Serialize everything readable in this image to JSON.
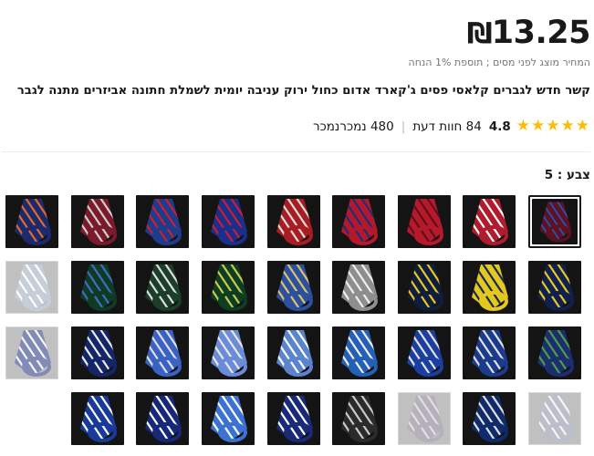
{
  "price": {
    "currency": "₪",
    "value": "13.25"
  },
  "tax_note": "המחיר מוצג לפני מסים ; תוספת 1% הנחה",
  "product_title": "קשר חדש לגברים קלאסי פסים ג'קארד אדום כחול ירוק עניבה יומית לשמלת חתונה אביזרים מתנה לגבר",
  "rating": {
    "value": "4.8",
    "stars": 5,
    "reviews": "84 חוות דעת",
    "sold": "480 נמכרנמכר",
    "separator": "|"
  },
  "color": {
    "label": "צבע : 5",
    "selected_index": 0
  },
  "swatches": [
    {
      "base": "#5e1220",
      "stripe": "#2b4fb0",
      "dim": false
    },
    {
      "base": "#b01c2e",
      "stripe": "#ffffff",
      "dim": false
    },
    {
      "base": "#b5192b",
      "stripe": "#5e0f18",
      "dim": false
    },
    {
      "base": "#b3182b",
      "stripe": "#1d2f7a",
      "dim": false
    },
    {
      "base": "#a81d22",
      "stripe": "#dcdcdc",
      "dim": false
    },
    {
      "base": "#1a2e8c",
      "stripe": "#c8202e",
      "dim": false
    },
    {
      "base": "#1e3c8e",
      "stripe": "#c8202e",
      "dim": false
    },
    {
      "base": "#7b1a2a",
      "stripe": "#cfcfcf",
      "dim": false
    },
    {
      "base": "#1b2a6e",
      "stripe": "#e06a2a",
      "dim": false
    },
    {
      "base": "#10214f",
      "stripe": "#e8c81e",
      "dim": false
    },
    {
      "base": "#e4c71f",
      "stripe": "#14285a",
      "dim": false
    },
    {
      "base": "#0f1d3f",
      "stripe": "#e8c81e",
      "dim": false
    },
    {
      "base": "#8e8e8e",
      "stripe": "#eeeeee",
      "dim": false
    },
    {
      "base": "#2c4f9e",
      "stripe": "#d9c36b",
      "dim": false
    },
    {
      "base": "#0d3d22",
      "stripe": "#c9c94a",
      "dim": false
    },
    {
      "base": "#1b3e2a",
      "stripe": "#dddddd",
      "dim": false
    },
    {
      "base": "#0f3a24",
      "stripe": "#3c6fc4",
      "dim": false
    },
    {
      "base": "#9aa5b8",
      "stripe": "#ffffff",
      "dim": true
    },
    {
      "base": "#1c2e6e",
      "stripe": "#4a9e4a",
      "dim": false
    },
    {
      "base": "#1b3c8e",
      "stripe": "#e3e3e3",
      "dim": false
    },
    {
      "base": "#1a3fa0",
      "stripe": "#e3e3e3",
      "dim": false
    },
    {
      "base": "#2560b8",
      "stripe": "#f0f0f0",
      "dim": false
    },
    {
      "base": "#5b84cf",
      "stripe": "#ffffff",
      "dim": false
    },
    {
      "base": "#6a8bd8",
      "stripe": "#e8e8e8",
      "dim": false
    },
    {
      "base": "#3a62c4",
      "stripe": "#e0e0e0",
      "dim": false
    },
    {
      "base": "#14256a",
      "stripe": "#ededed",
      "dim": false
    },
    {
      "base": "#1a2d7a",
      "stripe": "#f2f2f2",
      "dim": true
    },
    {
      "base": "#848aa0",
      "stripe": "#eeeeee",
      "dim": true
    },
    {
      "base": "#0f2b6b",
      "stripe": "#e0e0e0",
      "dim": false
    },
    {
      "base": "#7a6f86",
      "stripe": "#c7c7c7",
      "dim": true
    },
    {
      "base": "#2b2b2b",
      "stripe": "#c9c9c9",
      "dim": false
    },
    {
      "base": "#1a2a7a",
      "stripe": "#ffffff",
      "dim": false
    },
    {
      "base": "#3c73d2",
      "stripe": "#ffffff",
      "dim": false
    },
    {
      "base": "#17287a",
      "stripe": "#ffffff",
      "dim": false
    },
    {
      "base": "#1a3a9a",
      "stripe": "#ffffff",
      "dim": false
    }
  ]
}
